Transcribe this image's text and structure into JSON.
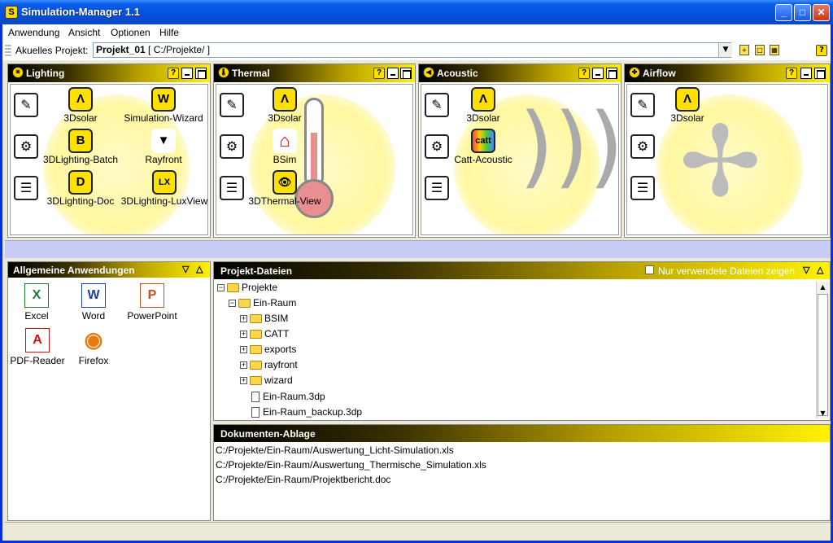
{
  "window": {
    "title": "Simulation-Manager 1.1",
    "min": "_",
    "max": "□",
    "close": "✕"
  },
  "menu": [
    "Anwendung",
    "Ansicht",
    "Optionen",
    "Hilfe"
  ],
  "project": {
    "label": "Akuelles Projekt:",
    "name": "Projekt_01",
    "path": "[ C:/Projekte/ ]"
  },
  "help_glyph": "?",
  "tools": {
    "edit": "✎",
    "settings": "⚙",
    "doc": "☰"
  },
  "panels": {
    "lighting": {
      "title": "Lighting",
      "apps": [
        {
          "label": "3Dsolar",
          "glyph": "Λ"
        },
        {
          "label": "Simulation-Wizard",
          "glyph": "W"
        },
        {
          "label": "3DLighting-Batch",
          "glyph": "B"
        },
        {
          "label": "Rayfront",
          "glyph": "▼"
        },
        {
          "label": "3DLighting-Doc",
          "glyph": "D"
        },
        {
          "label": "3DLighting-LuxView",
          "glyph": "LX"
        }
      ]
    },
    "thermal": {
      "title": "Thermal",
      "apps": [
        {
          "label": "3Dsolar",
          "glyph": "Λ"
        },
        {
          "label": "BSim",
          "glyph": "⌂"
        },
        {
          "label": "3DThermal-View",
          "glyph": "👁"
        }
      ]
    },
    "acoustic": {
      "title": "Acoustic",
      "apps": [
        {
          "label": "3Dsolar",
          "glyph": "Λ"
        },
        {
          "label": "Catt-Acoustic",
          "glyph": "catt"
        }
      ]
    },
    "airflow": {
      "title": "Airflow",
      "apps": [
        {
          "label": "3Dsolar",
          "glyph": "Λ"
        }
      ]
    }
  },
  "general": {
    "title": "Allgemeine Anwendungen",
    "apps": [
      {
        "label": "Excel",
        "glyph": "X",
        "color": "#1e7d32"
      },
      {
        "label": "Word",
        "glyph": "W",
        "color": "#1c3fa8"
      },
      {
        "label": "PowerPoint",
        "glyph": "P",
        "color": "#c8501e"
      },
      {
        "label": "PDF-Reader",
        "glyph": "A",
        "color": "#d01010"
      },
      {
        "label": "Firefox",
        "glyph": "◉",
        "color": "#e87a10"
      }
    ]
  },
  "files": {
    "title": "Projekt-Dateien",
    "only_used": "Nur verwendete Dateien zeigen",
    "tree": [
      {
        "label": "Projekte",
        "type": "folder",
        "toggle": "−",
        "level": 0
      },
      {
        "label": "Ein-Raum",
        "type": "folder",
        "toggle": "−",
        "level": 1
      },
      {
        "label": "BSIM",
        "type": "folder",
        "toggle": "+",
        "level": 2
      },
      {
        "label": "CATT",
        "type": "folder",
        "toggle": "+",
        "level": 2
      },
      {
        "label": "exports",
        "type": "folder",
        "toggle": "+",
        "level": 2
      },
      {
        "label": "rayfront",
        "type": "folder",
        "toggle": "+",
        "level": 2
      },
      {
        "label": "wizard",
        "type": "folder",
        "toggle": "+",
        "level": 2
      },
      {
        "label": "Ein-Raum.3dp",
        "type": "file",
        "toggle": "",
        "level": 2
      },
      {
        "label": "Ein-Raum_backup.3dp",
        "type": "file",
        "toggle": "",
        "level": 2
      }
    ]
  },
  "docs": {
    "title": "Dokumenten-Ablage",
    "items": [
      "C:/Projekte/Ein-Raum/Auswertung_Licht-Simulation.xls",
      "C:/Projekte/Ein-Raum/Auswertung_Thermische_Simulation.xls",
      "C:/Projekte/Ein-Raum/Projektbericht.doc"
    ]
  },
  "colors": {
    "title_bar": "#0550dc",
    "header_gradient_end": "#fff200",
    "icon_yellow": "#ffe100",
    "blue_strip": "#c8ccf5"
  }
}
